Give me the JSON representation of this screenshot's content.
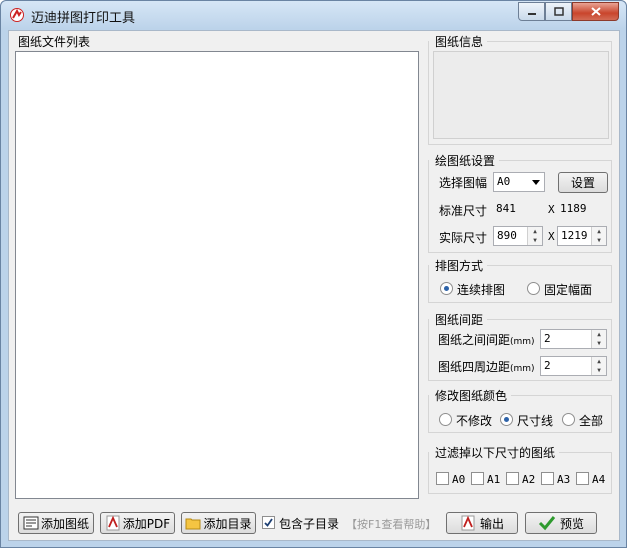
{
  "window": {
    "title": "迈迪拼图打印工具"
  },
  "file_list": {
    "header": "图纸文件列表"
  },
  "info": {
    "header": "图纸信息"
  },
  "paper_settings": {
    "header": "绘图纸设置",
    "select_label": "选择图幅",
    "select_value": "A0",
    "settings_button": "设置",
    "standard_label": "标准尺寸",
    "standard_w": "841",
    "standard_h": "1189",
    "actual_label": "实际尺寸",
    "actual_w": "890",
    "actual_h": "1219",
    "x_sep": "X"
  },
  "layout_mode": {
    "header": "排图方式",
    "options": [
      "连续排图",
      "固定幅面"
    ],
    "selected": "连续排图"
  },
  "spacing": {
    "header": "图纸间距",
    "between_label": "图纸之间间距",
    "around_label": "图纸四周边距",
    "unit": "(mm)",
    "between_value": "2",
    "around_value": "2"
  },
  "color": {
    "header": "修改图纸颜色",
    "options": [
      "不修改",
      "尺寸线",
      "全部"
    ],
    "selected": "尺寸线"
  },
  "filter": {
    "header": "过滤掉以下尺寸的图纸",
    "options": [
      "A0",
      "A1",
      "A2",
      "A3",
      "A4"
    ]
  },
  "bottom": {
    "add_drawing": "添加图纸",
    "add_pdf": "添加PDF",
    "add_dir": "添加目录",
    "include_sub": "包含子目录",
    "include_sub_checked": true,
    "help_hint": "【按F1查看帮助】",
    "output": "输出",
    "preview": "预览"
  }
}
